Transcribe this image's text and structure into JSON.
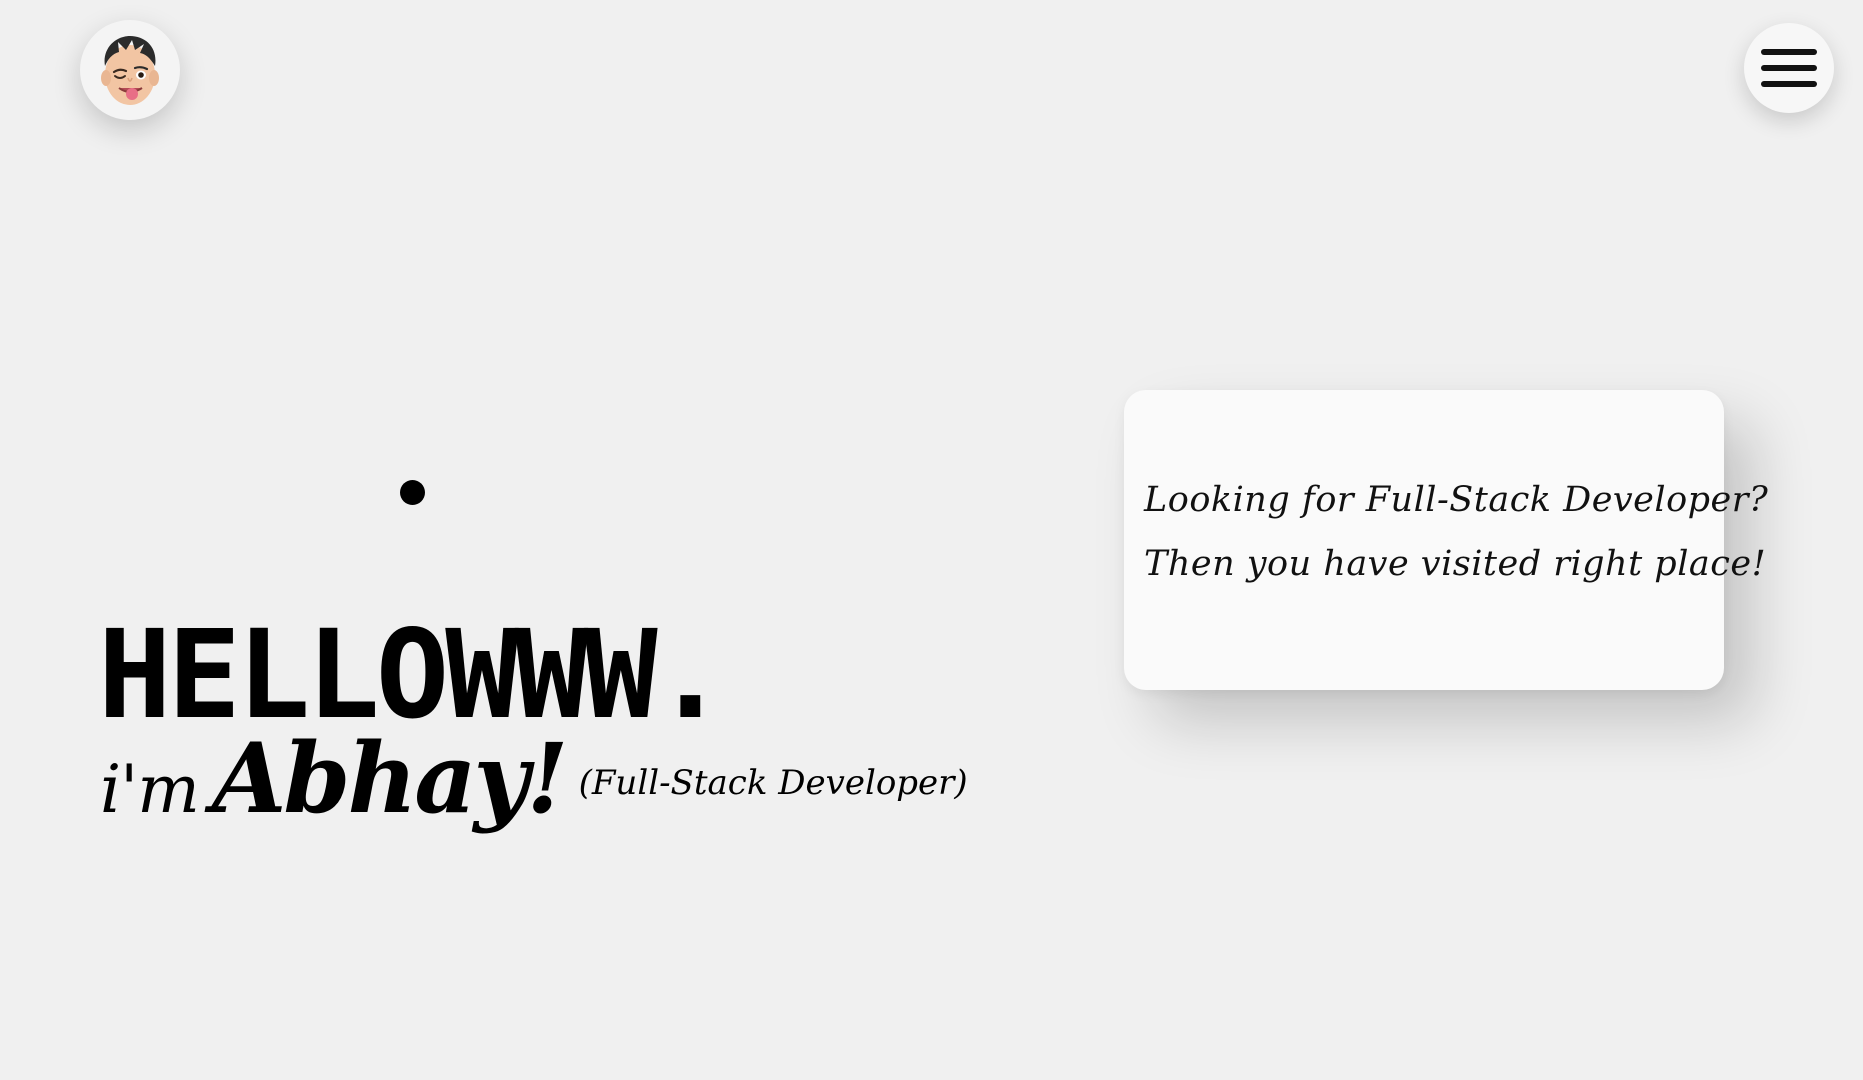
{
  "header": {
    "avatar_icon": "memoji-avatar-icon",
    "menu_icon": "hamburger-menu-icon"
  },
  "hero": {
    "headline": "HELLOWWW.",
    "intro_prefix": "i'm",
    "name": "Abhay!",
    "role": "(Full-Stack Developer)"
  },
  "card": {
    "line1": "Looking for Full-Stack Developer?",
    "line2": "Then you have visited right place!"
  },
  "colors": {
    "background": "#f0f0f0",
    "card_background": "#fafafa",
    "text": "#000000"
  }
}
